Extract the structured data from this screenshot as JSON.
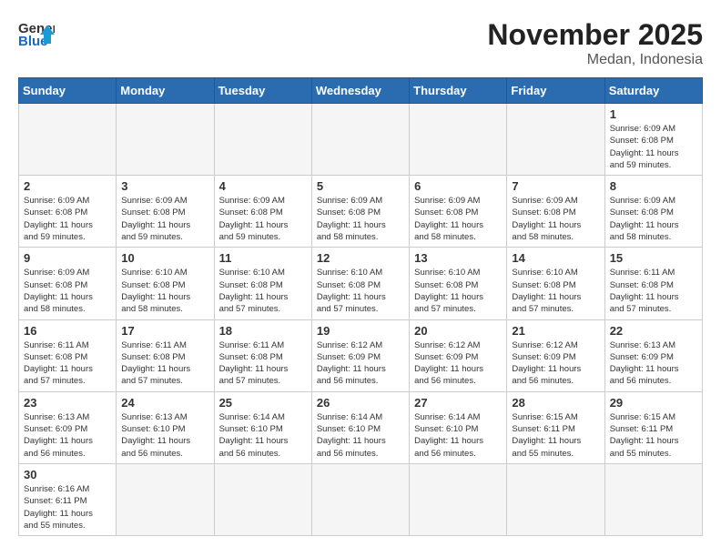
{
  "logo": {
    "line1": "General",
    "line2": "Blue"
  },
  "title": "November 2025",
  "subtitle": "Medan, Indonesia",
  "days_of_week": [
    "Sunday",
    "Monday",
    "Tuesday",
    "Wednesday",
    "Thursday",
    "Friday",
    "Saturday"
  ],
  "weeks": [
    [
      {
        "day": "",
        "info": ""
      },
      {
        "day": "",
        "info": ""
      },
      {
        "day": "",
        "info": ""
      },
      {
        "day": "",
        "info": ""
      },
      {
        "day": "",
        "info": ""
      },
      {
        "day": "",
        "info": ""
      },
      {
        "day": "1",
        "info": "Sunrise: 6:09 AM\nSunset: 6:08 PM\nDaylight: 11 hours\nand 59 minutes."
      }
    ],
    [
      {
        "day": "2",
        "info": "Sunrise: 6:09 AM\nSunset: 6:08 PM\nDaylight: 11 hours\nand 59 minutes."
      },
      {
        "day": "3",
        "info": "Sunrise: 6:09 AM\nSunset: 6:08 PM\nDaylight: 11 hours\nand 59 minutes."
      },
      {
        "day": "4",
        "info": "Sunrise: 6:09 AM\nSunset: 6:08 PM\nDaylight: 11 hours\nand 59 minutes."
      },
      {
        "day": "5",
        "info": "Sunrise: 6:09 AM\nSunset: 6:08 PM\nDaylight: 11 hours\nand 58 minutes."
      },
      {
        "day": "6",
        "info": "Sunrise: 6:09 AM\nSunset: 6:08 PM\nDaylight: 11 hours\nand 58 minutes."
      },
      {
        "day": "7",
        "info": "Sunrise: 6:09 AM\nSunset: 6:08 PM\nDaylight: 11 hours\nand 58 minutes."
      },
      {
        "day": "8",
        "info": "Sunrise: 6:09 AM\nSunset: 6:08 PM\nDaylight: 11 hours\nand 58 minutes."
      }
    ],
    [
      {
        "day": "9",
        "info": "Sunrise: 6:09 AM\nSunset: 6:08 PM\nDaylight: 11 hours\nand 58 minutes."
      },
      {
        "day": "10",
        "info": "Sunrise: 6:10 AM\nSunset: 6:08 PM\nDaylight: 11 hours\nand 58 minutes."
      },
      {
        "day": "11",
        "info": "Sunrise: 6:10 AM\nSunset: 6:08 PM\nDaylight: 11 hours\nand 57 minutes."
      },
      {
        "day": "12",
        "info": "Sunrise: 6:10 AM\nSunset: 6:08 PM\nDaylight: 11 hours\nand 57 minutes."
      },
      {
        "day": "13",
        "info": "Sunrise: 6:10 AM\nSunset: 6:08 PM\nDaylight: 11 hours\nand 57 minutes."
      },
      {
        "day": "14",
        "info": "Sunrise: 6:10 AM\nSunset: 6:08 PM\nDaylight: 11 hours\nand 57 minutes."
      },
      {
        "day": "15",
        "info": "Sunrise: 6:11 AM\nSunset: 6:08 PM\nDaylight: 11 hours\nand 57 minutes."
      }
    ],
    [
      {
        "day": "16",
        "info": "Sunrise: 6:11 AM\nSunset: 6:08 PM\nDaylight: 11 hours\nand 57 minutes."
      },
      {
        "day": "17",
        "info": "Sunrise: 6:11 AM\nSunset: 6:08 PM\nDaylight: 11 hours\nand 57 minutes."
      },
      {
        "day": "18",
        "info": "Sunrise: 6:11 AM\nSunset: 6:08 PM\nDaylight: 11 hours\nand 57 minutes."
      },
      {
        "day": "19",
        "info": "Sunrise: 6:12 AM\nSunset: 6:09 PM\nDaylight: 11 hours\nand 56 minutes."
      },
      {
        "day": "20",
        "info": "Sunrise: 6:12 AM\nSunset: 6:09 PM\nDaylight: 11 hours\nand 56 minutes."
      },
      {
        "day": "21",
        "info": "Sunrise: 6:12 AM\nSunset: 6:09 PM\nDaylight: 11 hours\nand 56 minutes."
      },
      {
        "day": "22",
        "info": "Sunrise: 6:13 AM\nSunset: 6:09 PM\nDaylight: 11 hours\nand 56 minutes."
      }
    ],
    [
      {
        "day": "23",
        "info": "Sunrise: 6:13 AM\nSunset: 6:09 PM\nDaylight: 11 hours\nand 56 minutes."
      },
      {
        "day": "24",
        "info": "Sunrise: 6:13 AM\nSunset: 6:10 PM\nDaylight: 11 hours\nand 56 minutes."
      },
      {
        "day": "25",
        "info": "Sunrise: 6:14 AM\nSunset: 6:10 PM\nDaylight: 11 hours\nand 56 minutes."
      },
      {
        "day": "26",
        "info": "Sunrise: 6:14 AM\nSunset: 6:10 PM\nDaylight: 11 hours\nand 56 minutes."
      },
      {
        "day": "27",
        "info": "Sunrise: 6:14 AM\nSunset: 6:10 PM\nDaylight: 11 hours\nand 56 minutes."
      },
      {
        "day": "28",
        "info": "Sunrise: 6:15 AM\nSunset: 6:11 PM\nDaylight: 11 hours\nand 55 minutes."
      },
      {
        "day": "29",
        "info": "Sunrise: 6:15 AM\nSunset: 6:11 PM\nDaylight: 11 hours\nand 55 minutes."
      }
    ],
    [
      {
        "day": "30",
        "info": "Sunrise: 6:16 AM\nSunset: 6:11 PM\nDaylight: 11 hours\nand 55 minutes."
      },
      {
        "day": "",
        "info": ""
      },
      {
        "day": "",
        "info": ""
      },
      {
        "day": "",
        "info": ""
      },
      {
        "day": "",
        "info": ""
      },
      {
        "day": "",
        "info": ""
      },
      {
        "day": "",
        "info": ""
      }
    ]
  ]
}
